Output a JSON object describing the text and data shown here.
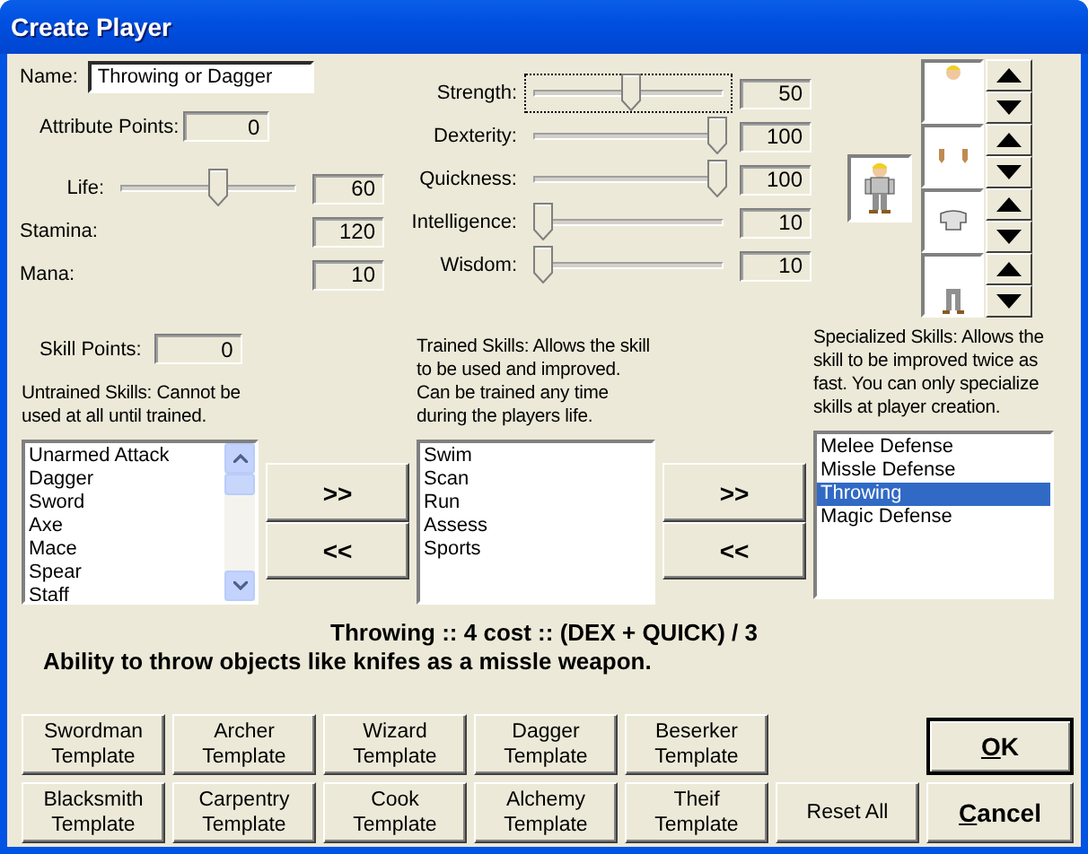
{
  "window": {
    "title": "Create Player"
  },
  "name": {
    "label": "Name:",
    "value": "Throwing or Dagger"
  },
  "attribute_points": {
    "label": "Attribute Points:",
    "value": "0"
  },
  "vitals": [
    {
      "kind": "slider",
      "label": "Life:",
      "value": "60",
      "level": 0.55
    },
    {
      "kind": "readout",
      "label": "Stamina:",
      "value": "120"
    },
    {
      "kind": "readout",
      "label": "Mana:",
      "value": "10"
    }
  ],
  "attributes": [
    {
      "label": "Strength:",
      "value": "50",
      "level": 0.5,
      "focused": true
    },
    {
      "label": "Dexterity:",
      "value": "100",
      "level": 1,
      "focused": false
    },
    {
      "label": "Quickness:",
      "value": "100",
      "level": 1,
      "focused": false
    },
    {
      "label": "Intelligence:",
      "value": "10",
      "level": 0,
      "focused": false
    },
    {
      "label": "Wisdom:",
      "value": "10",
      "level": 0,
      "focused": false
    }
  ],
  "appearance": {
    "preview": {
      "kind": "figure"
    },
    "slots": [
      {
        "kind": "head"
      },
      {
        "kind": "hands"
      },
      {
        "kind": "shirt"
      },
      {
        "kind": "pants"
      }
    ]
  },
  "skill_points": {
    "label": "Skill Points:",
    "value": "0"
  },
  "untrained": {
    "caption": "Untrained Skills: Cannot be used at all until trained.",
    "scrollable": true,
    "items": [
      {
        "label": "Unarmed Attack",
        "selected": false
      },
      {
        "label": "Dagger",
        "selected": false
      },
      {
        "label": "Sword",
        "selected": false
      },
      {
        "label": "Axe",
        "selected": false
      },
      {
        "label": "Mace",
        "selected": false
      },
      {
        "label": "Spear",
        "selected": false
      },
      {
        "label": "Staff",
        "selected": false
      }
    ]
  },
  "transfer_left": [
    ">>",
    "<<"
  ],
  "trained": {
    "caption": "Trained Skills: Allows the skill to be used and improved. Can be trained any time during the players life.",
    "scrollable": false,
    "items": [
      {
        "label": "Swim",
        "selected": false
      },
      {
        "label": "Scan",
        "selected": false
      },
      {
        "label": "Run",
        "selected": false
      },
      {
        "label": "Assess",
        "selected": false
      },
      {
        "label": "Sports",
        "selected": false
      }
    ]
  },
  "transfer_right": [
    ">>",
    "<<"
  ],
  "specialized": {
    "caption": "Specialized Skills: Allows the skill to be improved twice as fast. You can only specialize skills at player creation.",
    "scrollable": false,
    "items": [
      {
        "label": "Melee Defense",
        "selected": false
      },
      {
        "label": "Missle Defense",
        "selected": false
      },
      {
        "label": "Throwing",
        "selected": true
      },
      {
        "label": "Magic Defense",
        "selected": false
      }
    ]
  },
  "description": {
    "title": "Throwing :: 4 cost :: (DEX + QUICK) / 3",
    "text": "Ability to throw objects like knifes as a missle weapon."
  },
  "templates": [
    {
      "line1": "Swordman",
      "line2": "Template"
    },
    {
      "line1": "Archer",
      "line2": "Template"
    },
    {
      "line1": "Wizard",
      "line2": "Template"
    },
    {
      "line1": "Dagger",
      "line2": "Template"
    },
    {
      "line1": "Beserker",
      "line2": "Template"
    },
    {
      "line1": "Blacksmith",
      "line2": "Template"
    },
    {
      "line1": "Carpentry",
      "line2": "Template"
    },
    {
      "line1": "Cook",
      "line2": "Template"
    },
    {
      "line1": "Alchemy",
      "line2": "Template"
    },
    {
      "line1": "Theif",
      "line2": "Template"
    }
  ],
  "reset_button": "Reset All",
  "ok_button": {
    "first": "O",
    "rest": "K",
    "default": true
  },
  "cancel_button": {
    "first": "C",
    "rest": "ancel",
    "default": false
  }
}
